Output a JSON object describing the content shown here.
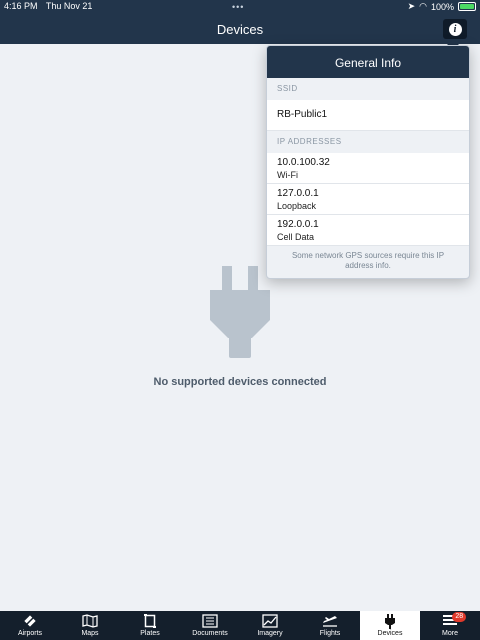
{
  "status": {
    "time": "4:16 PM",
    "date": "Thu Nov 21",
    "battery": "100%"
  },
  "header": {
    "title": "Devices"
  },
  "empty": {
    "message": "No supported devices connected"
  },
  "popover": {
    "title": "General Info",
    "ssid_header": "SSID",
    "ssid_value": "RB-Public1",
    "ip_header": "IP ADDRESSES",
    "ips": [
      {
        "address": "10.0.100.32",
        "type": "Wi-Fi"
      },
      {
        "address": "127.0.0.1",
        "type": "Loopback"
      },
      {
        "address": "192.0.0.1",
        "type": "Cell Data"
      }
    ],
    "footer": "Some network GPS sources require this IP address info."
  },
  "tabs": [
    {
      "label": "Airports",
      "icon": "airports-icon"
    },
    {
      "label": "Maps",
      "icon": "maps-icon"
    },
    {
      "label": "Plates",
      "icon": "plates-icon"
    },
    {
      "label": "Documents",
      "icon": "documents-icon"
    },
    {
      "label": "Imagery",
      "icon": "imagery-icon"
    },
    {
      "label": "Flights",
      "icon": "flights-icon"
    },
    {
      "label": "Devices",
      "icon": "plug-icon",
      "active": true
    },
    {
      "label": "More",
      "icon": "menu-icon",
      "badge": "28"
    }
  ],
  "colors": {
    "header": "#22354b",
    "tabbar": "#141f2c",
    "badge": "#e0392b",
    "background": "#eef1f5"
  }
}
